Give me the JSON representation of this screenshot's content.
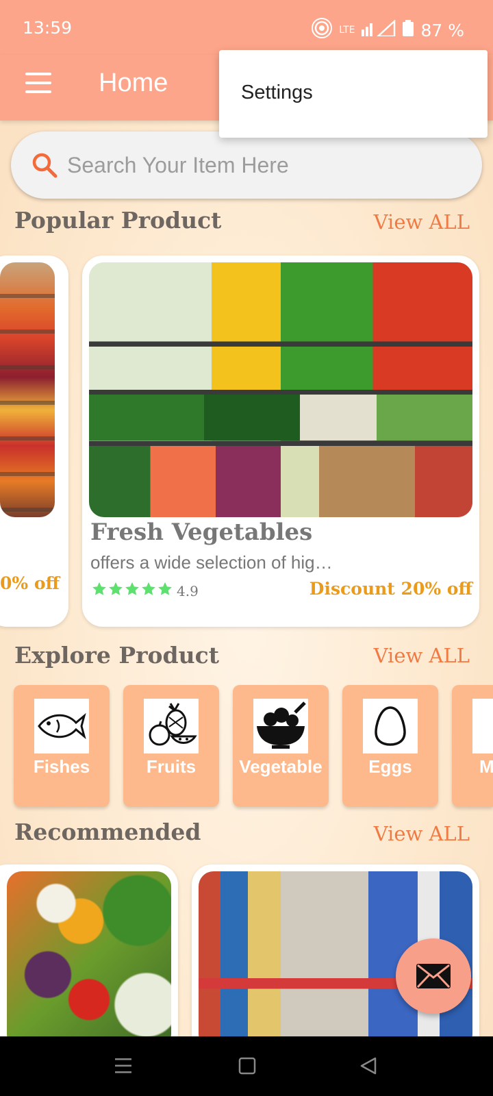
{
  "status_bar": {
    "time": "13:59",
    "network": "LTE",
    "battery": "87 %"
  },
  "app_bar": {
    "title": "Home"
  },
  "menu_popup": {
    "items": [
      "Settings"
    ]
  },
  "search": {
    "placeholder": "Search Your Item Here"
  },
  "sections": {
    "popular": {
      "title": "Popular Product",
      "view_all": "View ALL"
    },
    "explore": {
      "title": "Explore Product",
      "view_all": "View ALL"
    },
    "recommended": {
      "title": "Recommended",
      "view_all": "View ALL"
    }
  },
  "popular_products": [
    {
      "discount_partial": "0% off"
    },
    {
      "title": "Fresh Vegetables",
      "description": "offers a wide selection of hig…",
      "rating": "4.9",
      "stars": 5,
      "discount": "Discount 20% off"
    }
  ],
  "categories": [
    {
      "label": "Fishes",
      "icon": "fish-icon"
    },
    {
      "label": "Fruits",
      "icon": "fruits-icon"
    },
    {
      "label": "Vegetable",
      "icon": "vegetable-bowl-icon"
    },
    {
      "label": "Eggs",
      "icon": "egg-icon"
    },
    {
      "label": "M",
      "icon": "partial-icon"
    }
  ],
  "colors": {
    "primary": "#fda58a",
    "accent_text": "#f07a44",
    "discount": "#ea9b1c",
    "category_tile": "#fdb98b",
    "star": "#5de06e"
  }
}
